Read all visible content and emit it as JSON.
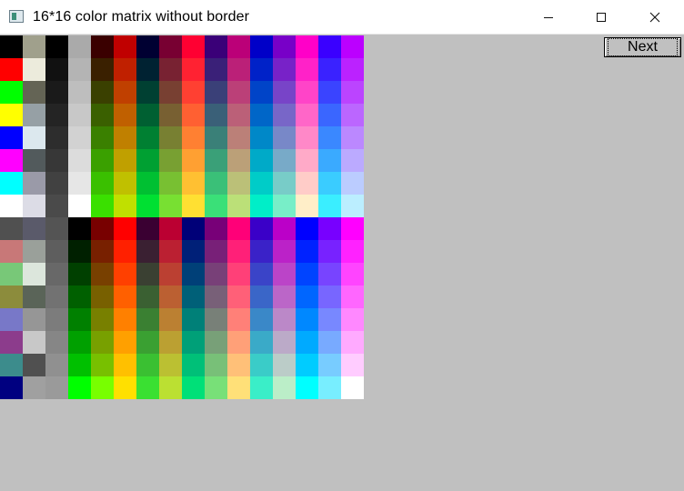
{
  "window": {
    "title": "16*16 color matrix without border",
    "icon": "app-window-icon",
    "controls": [
      "minimize-icon",
      "maximize-icon",
      "close-icon"
    ]
  },
  "toolbar": {
    "next_label": "Next"
  },
  "background_color": "#c0c0c0",
  "matrix": {
    "rows": 16,
    "cols": 16,
    "colors": [
      [
        "#000000",
        "#a0a08c",
        "#000000",
        "#aaaaaa",
        "#3a0000",
        "#c00000",
        "#000032",
        "#780032",
        "#ff0032",
        "#3a0078",
        "#bb0078",
        "#0000c8",
        "#7800c8",
        "#ff00c8",
        "#3a00ff",
        "#bb00ff"
      ],
      [
        "#ff0000",
        "#ecebdc",
        "#111111",
        "#b4b4b4",
        "#3a2000",
        "#c02000",
        "#002232",
        "#782232",
        "#ff2232",
        "#3a2078",
        "#bb2078",
        "#0022c8",
        "#7822c8",
        "#ff22c8",
        "#3a22ff",
        "#bb22ff"
      ],
      [
        "#00ff00",
        "#646455",
        "#1a1a1a",
        "#bebebe",
        "#3a4000",
        "#c04000",
        "#004032",
        "#784032",
        "#ff4032",
        "#3a4078",
        "#bb4078",
        "#0044c8",
        "#7844c8",
        "#ff44c8",
        "#3a44ff",
        "#bb44ff"
      ],
      [
        "#ffff00",
        "#96a0a5",
        "#242424",
        "#c8c8c8",
        "#3a6000",
        "#c06000",
        "#006032",
        "#786032",
        "#ff6032",
        "#3a6078",
        "#bb6078",
        "#0066c8",
        "#7866c8",
        "#ff66c8",
        "#3a66ff",
        "#bb66ff"
      ],
      [
        "#0000ff",
        "#dce8ee",
        "#2d2d2d",
        "#d2d2d2",
        "#3a8000",
        "#c08000",
        "#008032",
        "#788032",
        "#ff8032",
        "#3a8078",
        "#bb8078",
        "#0088c8",
        "#7888c8",
        "#ff88c8",
        "#3a88ff",
        "#bb88ff"
      ],
      [
        "#ff00ff",
        "#525a5c",
        "#373737",
        "#dcdcdc",
        "#3aa000",
        "#c0a000",
        "#00a032",
        "#78a032",
        "#ffa032",
        "#3aa078",
        "#bba078",
        "#00aac8",
        "#78aac8",
        "#ffaac8",
        "#3aaaff",
        "#bbaaff"
      ],
      [
        "#00ffff",
        "#9a9aa8",
        "#414141",
        "#e6e6e6",
        "#3ac000",
        "#c0c000",
        "#00c032",
        "#78c032",
        "#ffc032",
        "#3ac078",
        "#bbc078",
        "#00ccc8",
        "#78ccc8",
        "#ffccc8",
        "#3accff",
        "#bbccff"
      ],
      [
        "#ffffff",
        "#dcdce6",
        "#4a4a4a",
        "#ffffff",
        "#3ae000",
        "#c0e000",
        "#00e032",
        "#78e032",
        "#ffe032",
        "#3ae078",
        "#bbe078",
        "#00eec8",
        "#78eec8",
        "#ffeec8",
        "#3aeeff",
        "#bbeeff"
      ],
      [
        "#505050",
        "#5a5a6a",
        "#545454",
        "#000000",
        "#780000",
        "#ff0000",
        "#3a0032",
        "#bb0032",
        "#000078",
        "#780078",
        "#ff0078",
        "#3a00c8",
        "#bb00c8",
        "#0000ff",
        "#7800ff",
        "#ff00ff"
      ],
      [
        "#c87878",
        "#9aa09a",
        "#5e5e5e",
        "#002000",
        "#782000",
        "#ff2000",
        "#3a2032",
        "#bb2032",
        "#002078",
        "#782078",
        "#ff2078",
        "#3a22c8",
        "#bb22c8",
        "#0022ff",
        "#7822ff",
        "#ff22ff"
      ],
      [
        "#78c878",
        "#dce6dc",
        "#686868",
        "#004000",
        "#784000",
        "#ff4000",
        "#3a4032",
        "#bb4032",
        "#004078",
        "#784078",
        "#ff4078",
        "#3a44c8",
        "#bb44c8",
        "#0044ff",
        "#7844ff",
        "#ff44ff"
      ],
      [
        "#8c8c3c",
        "#5a6458",
        "#727272",
        "#006000",
        "#786000",
        "#ff6000",
        "#3a6032",
        "#bb6032",
        "#006078",
        "#786078",
        "#ff6078",
        "#3a66c8",
        "#bb66c8",
        "#0066ff",
        "#7866ff",
        "#ff66ff"
      ],
      [
        "#7878c8",
        "#969696",
        "#7c7c7c",
        "#008000",
        "#788000",
        "#ff8000",
        "#3a8032",
        "#bb8032",
        "#008078",
        "#788078",
        "#ff8078",
        "#3a88c8",
        "#bb88c8",
        "#0088ff",
        "#7888ff",
        "#ff88ff"
      ],
      [
        "#8c3c8c",
        "#c8c8c8",
        "#868686",
        "#00a000",
        "#78a000",
        "#ffa000",
        "#3aa032",
        "#bba032",
        "#00a078",
        "#78a078",
        "#ffa078",
        "#3aaac8",
        "#bbaac8",
        "#00aaff",
        "#78aaff",
        "#ffaaff"
      ],
      [
        "#3c8c8c",
        "#505050",
        "#909090",
        "#00c000",
        "#78c000",
        "#ffc000",
        "#3ac032",
        "#bbc032",
        "#00c078",
        "#78c078",
        "#ffc078",
        "#3accc8",
        "#bbccc8",
        "#00ccff",
        "#78ccff",
        "#ffccff"
      ],
      [
        "#000080",
        "#a0a0a0",
        "#9a9a9a",
        "#00ff00",
        "#78ff00",
        "#ffe000",
        "#3ae032",
        "#bbe032",
        "#00e078",
        "#78e078",
        "#ffe078",
        "#3aeec8",
        "#bbeec8",
        "#00ffff",
        "#78eeff",
        "#ffffff"
      ]
    ]
  }
}
